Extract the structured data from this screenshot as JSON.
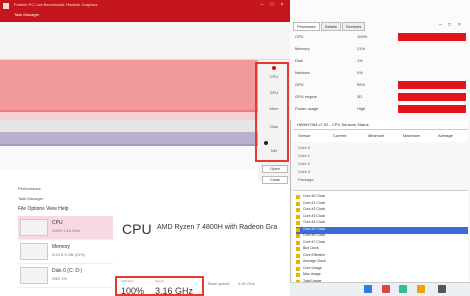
{
  "left_window": {
    "title": "Fortnite PC Live Benchmark: Radeon Graphics",
    "subtitle": "Task Manager",
    "side_items": [
      "All",
      "CPU",
      "GPU",
      "Mem",
      "Disk",
      "Net"
    ],
    "side_buttons": [
      "Open",
      "Close"
    ],
    "perf_header": "Performance",
    "perf_subheader": "Task Manager",
    "menu": "File  Options  View  Help",
    "perf_items": [
      {
        "name": "CPU",
        "detail": "100% 3.16 GHz"
      },
      {
        "name": "Memory",
        "detail": "3.2/15.3 GB (21%)"
      },
      {
        "name": "Disk 0 (C: D:)",
        "detail": "SSD 1%"
      }
    ],
    "cpu_title": "CPU",
    "cpu_name": "AMD Ryzen 7 4800H with Radeon Gra",
    "utilization_label": "Utilization",
    "utilization_value": "100%",
    "speed_label": "Speed",
    "speed_value": "3.16 GHz",
    "extra_label_1": "Base speed:",
    "extra_label_2": "2.90 GHz"
  },
  "right_window": {
    "tabs": [
      "Processes",
      "Details",
      "Services"
    ],
    "stats": [
      {
        "name": "CPU",
        "value": "100%"
      },
      {
        "name": "Memory",
        "value": "21%"
      },
      {
        "name": "Disk",
        "value": "1%"
      },
      {
        "name": "Network",
        "value": "0%"
      },
      {
        "name": "GPU",
        "value": "95%"
      },
      {
        "name": "GPU engine",
        "value": "3D"
      },
      {
        "name": "Power usage",
        "value": "High"
      }
    ],
    "mid_title": "HWiNFO64 v7.02 - CPU Sensors Status",
    "mid_cols": [
      "Sensor",
      "Current",
      "Minimum",
      "Maximum",
      "Average"
    ],
    "mid_rows": [
      "Core 0",
      "Core 1",
      "Core 2",
      "Core 3",
      "Package"
    ],
    "bottom_rows": [
      "Core #0 Clock",
      "Core #1 Clock",
      "Core #2 Clock",
      "Core #3 Clock",
      "Core #4 Clock",
      "Core #5 Clock",
      "Core #6 Clock",
      "Core #7 Clock",
      "Bus Clock",
      "Core Effective",
      "Average Clock",
      "Core Usage",
      "Max Usage",
      "Total Usage"
    ],
    "highlight_index": 5
  },
  "colors": {
    "accent": "#c4161c",
    "red_bar": "#e4141b",
    "highlight": "#3d6bd6"
  }
}
